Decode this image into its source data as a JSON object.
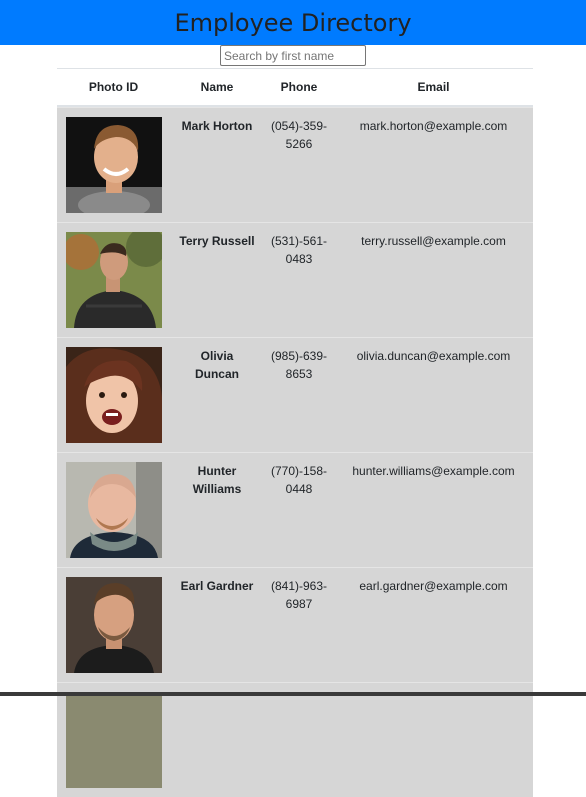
{
  "header": {
    "title": "Employee Directory"
  },
  "search": {
    "placeholder": "Search by first name",
    "value": ""
  },
  "table": {
    "columns": [
      "Photo ID",
      "Name",
      "Phone",
      "Email"
    ],
    "rows": [
      {
        "name": "Mark Horton",
        "phone": "(054)-359-5266",
        "email": "mark.horton@example.com"
      },
      {
        "name": "Terry Russell",
        "phone": "(531)-561-0483",
        "email": "terry.russell@example.com"
      },
      {
        "name": "Olivia Duncan",
        "phone": "(985)-639-8653",
        "email": "olivia.duncan@example.com"
      },
      {
        "name": "Hunter Williams",
        "phone": "(770)-158-0448",
        "email": "hunter.williams@example.com"
      },
      {
        "name": "Earl Gardner",
        "phone": "(841)-963-6987",
        "email": "earl.gardner@example.com"
      }
    ]
  },
  "colors": {
    "header_bg": "#007bff",
    "row_bg": "#d6d6d6"
  }
}
